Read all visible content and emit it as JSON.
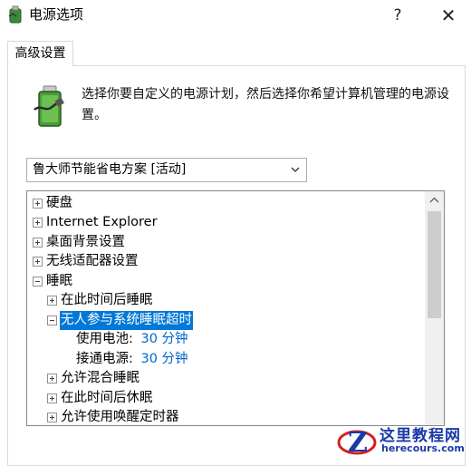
{
  "window": {
    "title": "电源选项",
    "help_label": "?",
    "close_label": "✕",
    "icon": "battery-plug-icon"
  },
  "tab": {
    "label": "高级设置"
  },
  "description": "选择你要自定义的电源计划，然后选择你希望计算机管理的电源设置。",
  "plan_select": {
    "value": "鲁大师节能省电方案 [活动]"
  },
  "tree": {
    "rows": [
      {
        "label": "硬盘",
        "expander": "plus"
      },
      {
        "label": "Internet Explorer",
        "expander": "plus"
      },
      {
        "label": "桌面背景设置",
        "expander": "plus"
      },
      {
        "label": "无线适配器设置",
        "expander": "plus"
      },
      {
        "label": "睡眠",
        "expander": "minus"
      },
      {
        "label": "在此时间后睡眠",
        "expander": "plus"
      },
      {
        "label": "无人参与系统睡眠超时",
        "expander": "minus",
        "selected": true
      },
      {
        "label": "使用电池:",
        "value": "30 分钟"
      },
      {
        "label": "接通电源:",
        "value": "30 分钟"
      },
      {
        "label": "允许混合睡眠",
        "expander": "plus"
      },
      {
        "label": "在此时间后休眠",
        "expander": "plus"
      },
      {
        "label": "允许使用唤醒定时器",
        "expander": "plus"
      }
    ]
  },
  "watermark": {
    "name": "这里教程网",
    "url": "herecours.com"
  },
  "colors": {
    "selection": "#0078d7",
    "value_blue": "#0066cc",
    "watermark": "#1a3aa8"
  }
}
